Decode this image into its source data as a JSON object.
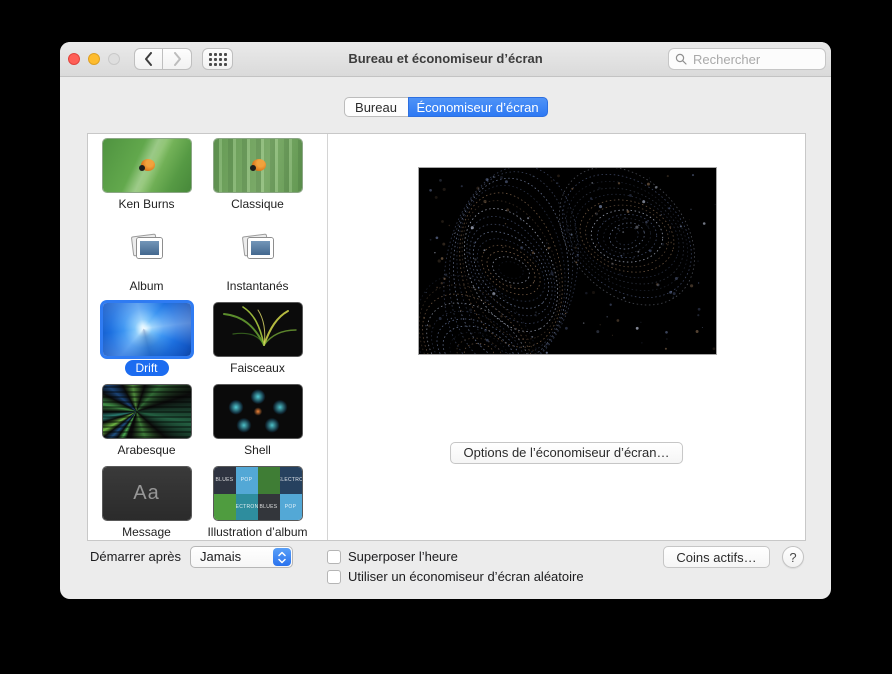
{
  "window": {
    "title": "Bureau et économiseur d’écran"
  },
  "toolbar": {
    "search_placeholder": "Rechercher"
  },
  "tabs": [
    {
      "label": "Bureau",
      "selected": false
    },
    {
      "label": "Économiseur d’écran",
      "selected": true
    }
  ],
  "savers": [
    {
      "name": "Ken Burns",
      "kind": "kenburns",
      "selected": false
    },
    {
      "name": "Classique",
      "kind": "classique",
      "selected": false
    },
    {
      "name": "Album",
      "kind": "album",
      "selected": false
    },
    {
      "name": "Instantanés",
      "kind": "snapshots",
      "selected": false
    },
    {
      "name": "Drift",
      "kind": "drift",
      "selected": true
    },
    {
      "name": "Faisceaux",
      "kind": "faisceaux",
      "selected": false
    },
    {
      "name": "Arabesque",
      "kind": "arabesque",
      "selected": false
    },
    {
      "name": "Shell",
      "kind": "shell",
      "selected": false
    },
    {
      "name": "Message",
      "kind": "message",
      "selected": false
    },
    {
      "name": "Illustration d’album",
      "kind": "albumart",
      "selected": false
    }
  ],
  "thumb_extras": {
    "message_text": "Aa",
    "albumart_tiles": [
      {
        "label": "BLUES",
        "color": "#2e3340"
      },
      {
        "label": "POP",
        "color": "#53a8d6"
      },
      {
        "label": "",
        "color": "#3f7d35"
      },
      {
        "label": "electro",
        "color": "#26415f"
      },
      {
        "label": "",
        "color": "#4f9c3f"
      },
      {
        "label": "electronic",
        "color": "#2e8d9e"
      },
      {
        "label": "BLUES",
        "color": "#33363b"
      },
      {
        "label": "POP",
        "color": "#53a8d6"
      }
    ]
  },
  "preview": {
    "options_button_label": "Options de l’économiseur d’écran…"
  },
  "footer": {
    "start_after_label": "Démarrer après",
    "start_after_value": "Jamais",
    "overlay_clock_label": "Superposer l’heure",
    "overlay_clock_checked": false,
    "random_saver_label": "Utiliser un économiseur d’écran aléatoire",
    "random_saver_checked": false,
    "hot_corners_label": "Coins actifs…",
    "help_label": "?"
  },
  "colors": {
    "accent_blue": "#2f7bf2",
    "selected_tab_blue": "#3b82f4",
    "window_bg": "#ececec",
    "preview_bg": "#000000"
  }
}
